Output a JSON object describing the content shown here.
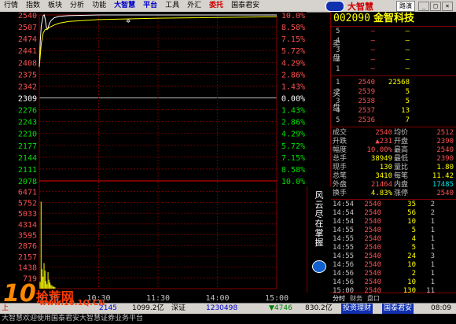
{
  "menu": {
    "items": [
      "行情",
      "指数",
      "板块",
      "分析",
      "功能",
      "大智慧",
      "平台",
      "工具",
      "外汇",
      "委托",
      "国泰君安"
    ],
    "brand": "大智慧",
    "route": "路演",
    "window_buttons": [
      "_",
      "□",
      "×"
    ]
  },
  "stock": {
    "code": "002090",
    "name": "金智科技"
  },
  "chart_data": {
    "type": "line",
    "x_ticks": [
      "9:30",
      "10:30",
      "11:30",
      "14:00",
      "15:00"
    ],
    "price_ticks_left": [
      "2540",
      "2507",
      "2474",
      "2441",
      "2408",
      "2375",
      "2342",
      "2309",
      "2276",
      "2243",
      "2210",
      "2177",
      "2144",
      "2111",
      "2078"
    ],
    "pct_ticks_right": [
      "10.0%",
      "8.58%",
      "7.15%",
      "5.72%",
      "4.29%",
      "2.86%",
      "1.43%",
      "0.00%",
      "1.43%",
      "2.86%",
      "4.29%",
      "5.72%",
      "7.15%",
      "8.58%",
      "10.0%"
    ],
    "ylim": [
      2078,
      2540
    ],
    "prev_close": 2309,
    "volume_ticks": [
      "6471",
      "5752",
      "5033",
      "4314",
      "3595",
      "2876",
      "2157",
      "1438",
      "719"
    ],
    "series": [
      {
        "values": [
          [
            0,
            2395
          ],
          [
            1,
            2470
          ],
          [
            2,
            2510
          ],
          [
            3,
            2525
          ],
          [
            4,
            2538
          ],
          [
            5,
            2540
          ],
          [
            6,
            2528
          ],
          [
            7,
            2508
          ],
          [
            8,
            2500
          ],
          [
            9,
            2505
          ],
          [
            10,
            2515
          ],
          [
            12,
            2525
          ],
          [
            15,
            2532
          ],
          [
            20,
            2536
          ],
          [
            30,
            2538
          ],
          [
            60,
            2540
          ],
          [
            120,
            2540
          ],
          [
            240,
            2540
          ]
        ]
      },
      {
        "values": [
          [
            0,
            2395
          ],
          [
            2,
            2460
          ],
          [
            4,
            2490
          ],
          [
            6,
            2500
          ],
          [
            8,
            2500
          ],
          [
            10,
            2505
          ],
          [
            15,
            2512
          ],
          [
            20,
            2517
          ],
          [
            30,
            2522
          ],
          [
            60,
            2527
          ],
          [
            120,
            2531
          ],
          [
            240,
            2535
          ]
        ]
      }
    ],
    "volume_bars": [
      [
        0,
        450
      ],
      [
        1,
        5800
      ],
      [
        2,
        1300
      ],
      [
        3,
        800
      ],
      [
        4,
        1700
      ],
      [
        5,
        1200
      ],
      [
        6,
        500
      ],
      [
        7,
        300
      ],
      [
        8,
        1100
      ],
      [
        9,
        600
      ],
      [
        10,
        400
      ],
      [
        11,
        250
      ],
      [
        12,
        200
      ],
      [
        13,
        150
      ],
      [
        14,
        120
      ],
      [
        15,
        100
      ]
    ]
  },
  "orderbook": {
    "sell_label": "卖盘",
    "buy_label": "买盘",
    "sell": [
      {
        "idx": "5",
        "price": "—",
        "vol": "—"
      },
      {
        "idx": "4",
        "price": "—",
        "vol": "—"
      },
      {
        "idx": "3",
        "price": "—",
        "vol": "—"
      },
      {
        "idx": "2",
        "price": "—",
        "vol": "—"
      },
      {
        "idx": "1",
        "price": "—",
        "vol": "—"
      }
    ],
    "buy": [
      {
        "idx": "1",
        "price": "2540",
        "vol": "22568",
        "chg": "",
        "extra": ""
      },
      {
        "idx": "2",
        "price": "2539",
        "vol": "5",
        "chg": "",
        "extra": ""
      },
      {
        "idx": "3",
        "price": "2538",
        "vol": "5",
        "chg": "",
        "extra": ""
      },
      {
        "idx": "4",
        "price": "2537",
        "vol": "13",
        "chg": "",
        "extra": ""
      },
      {
        "idx": "5",
        "price": "2536",
        "vol": "7",
        "chg": "",
        "extra": ""
      }
    ]
  },
  "stats": [
    {
      "l1": "成交",
      "v1": "2540",
      "c1": "red",
      "l2": "均价",
      "v2": "2512",
      "c2": "red"
    },
    {
      "l1": "升跌",
      "v1": "▲231",
      "c1": "red",
      "l2": "开盘",
      "v2": "2390",
      "c2": "red"
    },
    {
      "l1": "幅度",
      "v1": "10.00%",
      "c1": "red",
      "l2": "最高",
      "v2": "2540",
      "c2": "red"
    },
    {
      "l1": "总手",
      "v1": "38949",
      "c1": "yel",
      "l2": "最低",
      "v2": "2390",
      "c2": "red"
    },
    {
      "l1": "现手",
      "v1": "130",
      "c1": "yel",
      "l2": "量比",
      "v2": "1.80",
      "c2": "yel"
    },
    {
      "l1": "总笔",
      "v1": "3410",
      "c1": "yel",
      "l2": "每笔",
      "v2": "11.42",
      "c2": "yel"
    },
    {
      "l1": "外盘",
      "v1": "21464",
      "c1": "red",
      "l2": "内盘",
      "v2": "17485",
      "c2": "grn"
    },
    {
      "l1": "换手",
      "v1": "4.83%",
      "c1": "yel",
      "l2": "涨停",
      "v2": "2540",
      "c2": "red"
    }
  ],
  "ticks": [
    {
      "time": "14:54",
      "price": "2540",
      "vol": "35",
      "n": "2"
    },
    {
      "time": "14:54",
      "price": "2540",
      "vol": "56",
      "n": "2"
    },
    {
      "time": "14:54",
      "price": "2540",
      "vol": "10",
      "n": "1"
    },
    {
      "time": "14:55",
      "price": "2540",
      "vol": "5",
      "n": "1"
    },
    {
      "time": "14:55",
      "price": "2540",
      "vol": "4",
      "n": "1"
    },
    {
      "time": "14:55",
      "price": "2540",
      "vol": "5",
      "n": "1"
    },
    {
      "time": "14:55",
      "price": "2540",
      "vol": "24",
      "n": "3"
    },
    {
      "time": "14:56",
      "price": "2540",
      "vol": "10",
      "n": "1"
    },
    {
      "time": "14:56",
      "price": "2540",
      "vol": "2",
      "n": "1"
    },
    {
      "time": "14:56",
      "price": "2540",
      "vol": "10",
      "n": "1"
    },
    {
      "time": "15:00",
      "price": "2540",
      "vol": "130",
      "n": "11"
    }
  ],
  "tabs": [
    "分时",
    "财务",
    "盘口"
  ],
  "vertical_ad": "风云尽在掌握",
  "status": {
    "a": "上",
    "b": "2145",
    "c": "1099.2亿",
    "d": "深证",
    "e": "1230498",
    "f": "▼4746",
    "g": "830.2亿",
    "h": "投资理财",
    "i": "国泰君安",
    "time": "08:09"
  },
  "bottom_text": "大智慧欢迎使用国泰君安大智慧证券业务平台",
  "watermark": {
    "big": "10",
    "cn": "拾荒网",
    "url": "www.10.1Q.CN"
  }
}
